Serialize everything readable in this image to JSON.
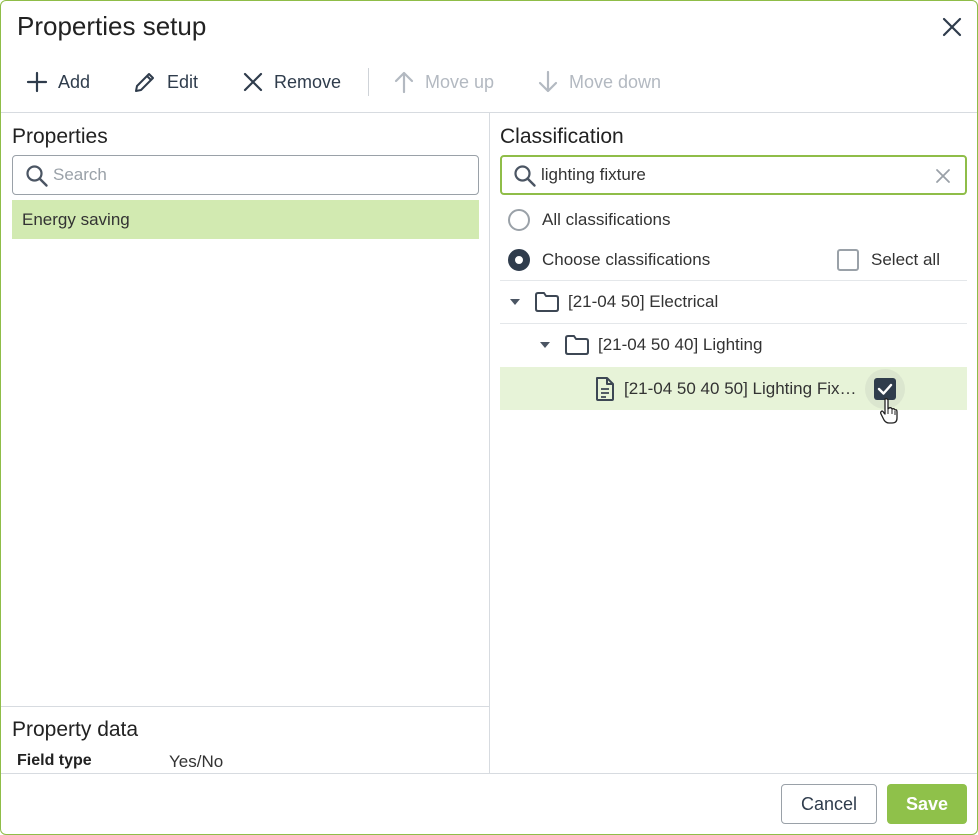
{
  "dialog": {
    "title": "Properties setup",
    "close_icon": "close-icon"
  },
  "toolbar": {
    "add_label": "Add",
    "edit_label": "Edit",
    "remove_label": "Remove",
    "move_up_label": "Move up",
    "move_down_label": "Move down"
  },
  "properties": {
    "title": "Properties",
    "search_placeholder": "Search",
    "items": [
      {
        "label": "Energy saving",
        "selected": true
      }
    ]
  },
  "property_data": {
    "title": "Property data",
    "field_type_label": "Field type",
    "field_type_value": "Yes/No"
  },
  "classification": {
    "title": "Classification",
    "search_value": "lighting fixture",
    "option_all": "All classifications",
    "option_choose": "Choose classifications",
    "selected_option": "choose",
    "select_all_label": "Select all",
    "tree": [
      {
        "label": "[21-04 50] Electrical",
        "type": "folder",
        "expanded": true
      },
      {
        "label": "[21-04 50 40] Lighting",
        "type": "folder",
        "expanded": true
      },
      {
        "label": "[21-04 50 40 50] Lighting Fix…",
        "type": "document",
        "checked": true
      }
    ]
  },
  "footer": {
    "cancel_label": "Cancel",
    "save_label": "Save"
  },
  "colors": {
    "accent": "#8fc14a",
    "selection": "#d2eab1",
    "dark": "#2f3c4c"
  }
}
